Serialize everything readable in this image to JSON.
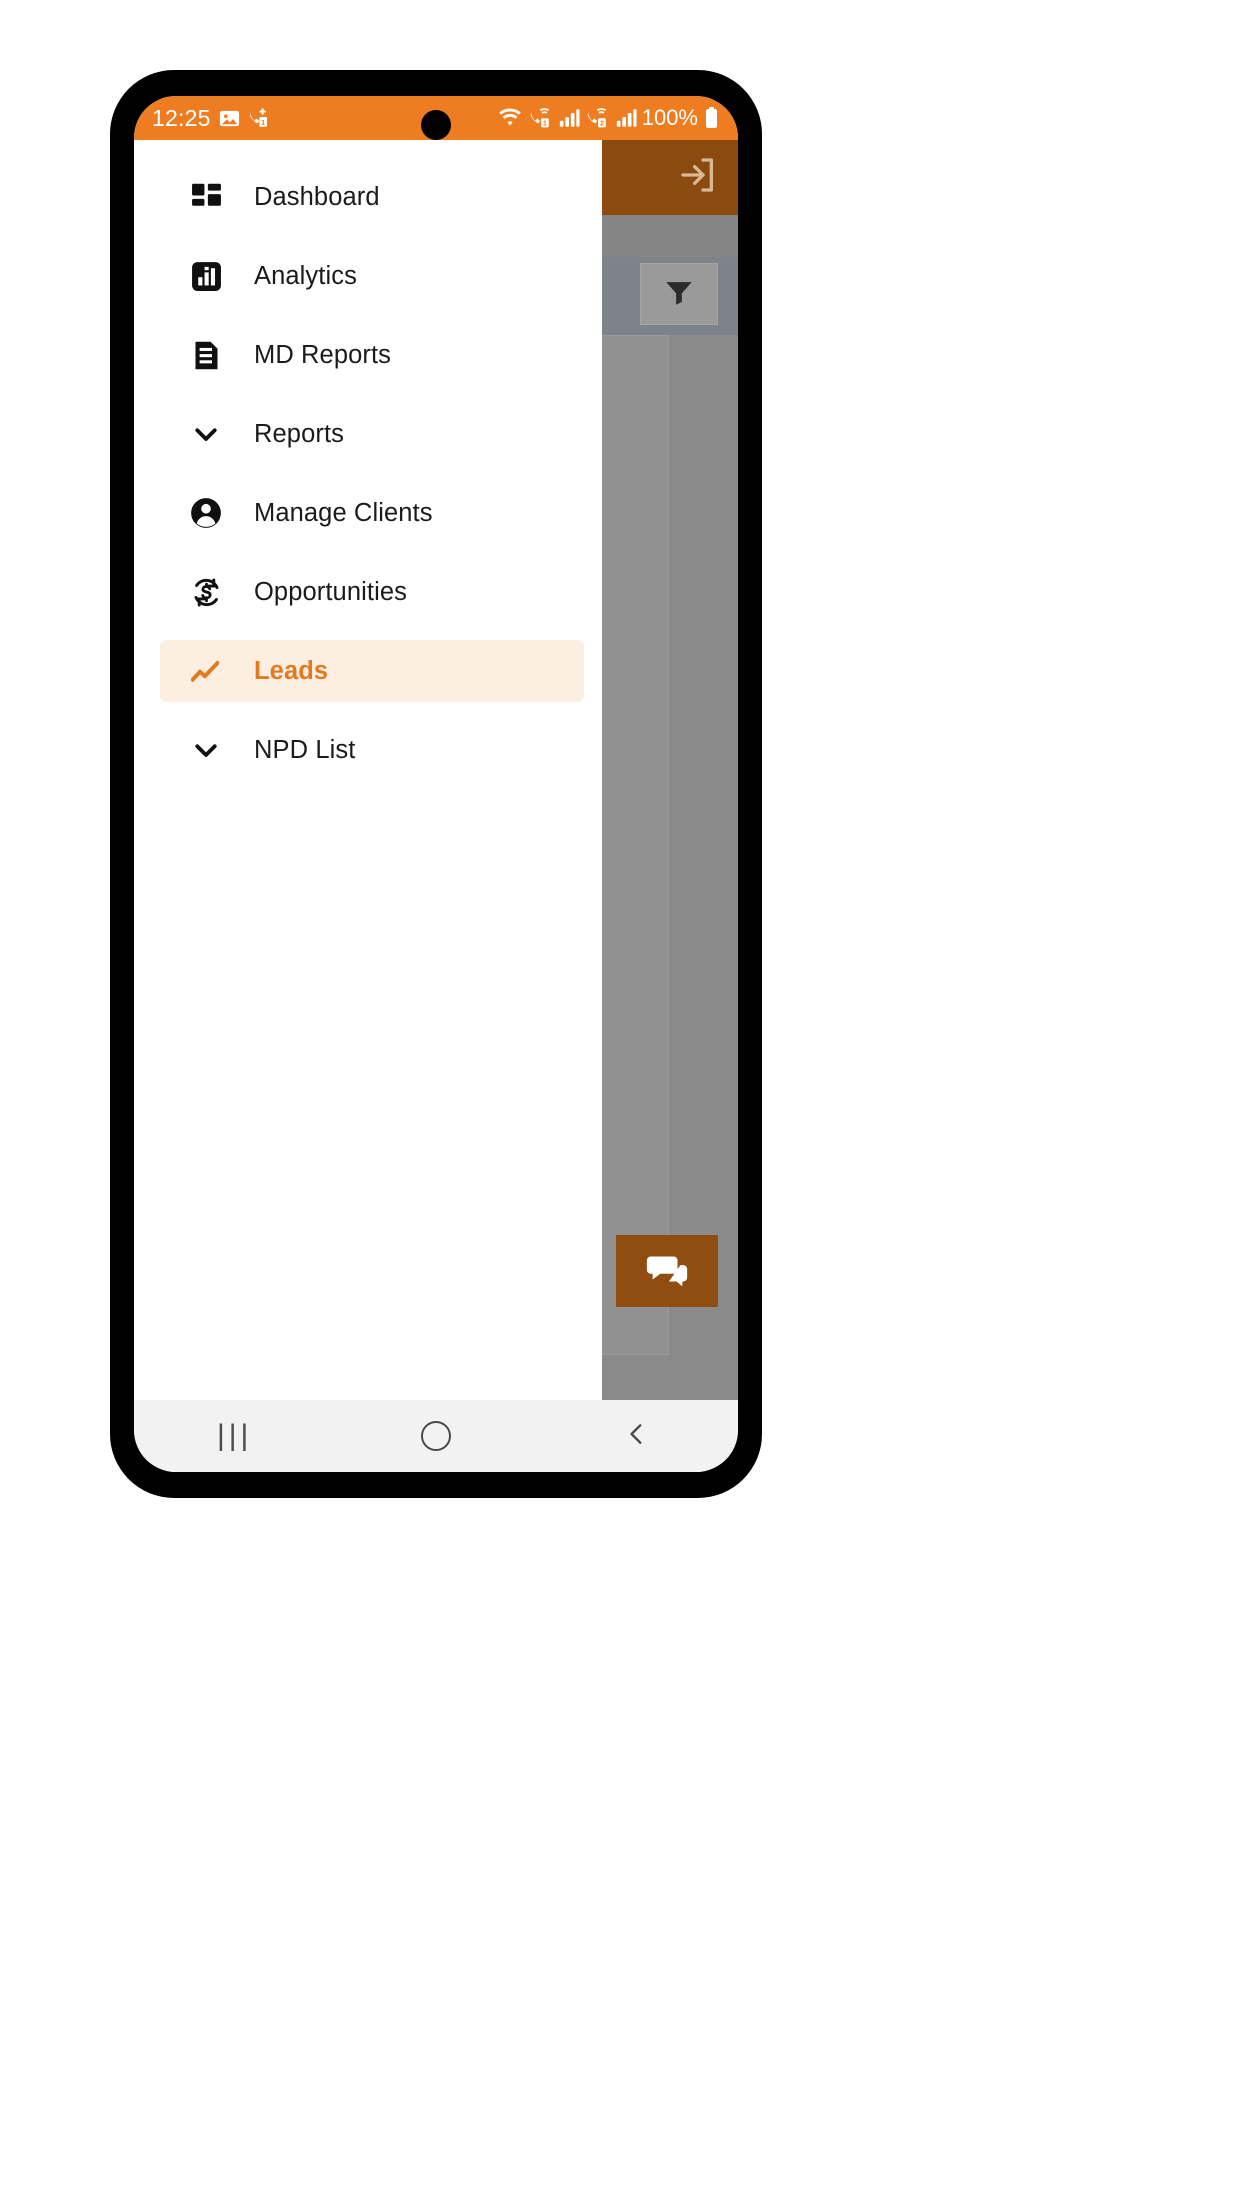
{
  "status_bar": {
    "time": "12:25",
    "battery_percent": "100%",
    "left_icons": [
      "photo-icon",
      "missed-call-sim1-icon"
    ],
    "right_icons": [
      "wifi-icon",
      "call-sim1-icon",
      "signal-bars-1-icon",
      "call-sim2-icon",
      "signal-bars-2-icon",
      "battery-icon"
    ],
    "background_color": "#ED7D20"
  },
  "drawer": {
    "background_color": "#FFFFFF",
    "active_item_background": "#FDEEE2",
    "active_item_color": "#E07B22",
    "items": [
      {
        "label": "Dashboard",
        "icon": "dashboard-grid-icon",
        "active": false,
        "expandable": false
      },
      {
        "label": "Analytics",
        "icon": "bar-chart-square-icon",
        "active": false,
        "expandable": false
      },
      {
        "label": "MD Reports",
        "icon": "document-lines-icon",
        "active": false,
        "expandable": false
      },
      {
        "label": "Reports",
        "icon": "chevron-down-icon",
        "active": false,
        "expandable": true
      },
      {
        "label": "Manage Clients",
        "icon": "account-circle-icon",
        "active": false,
        "expandable": false
      },
      {
        "label": "Opportunities",
        "icon": "currency-exchange-icon",
        "active": false,
        "expandable": false
      },
      {
        "label": "Leads",
        "icon": "trending-zigzag-icon",
        "active": true,
        "expandable": false
      },
      {
        "label": "NPD List",
        "icon": "chevron-down-icon",
        "active": false,
        "expandable": true
      }
    ]
  },
  "background_app": {
    "appbar_color": "#8A4A10",
    "logout_icon": "logout-arrow-icon",
    "filter_icon": "filter-funnel-icon",
    "add_button_label": "+",
    "chat_icon": "chat-bubbles-icon",
    "dim_overlay_color": "#8A8A8A"
  },
  "system_nav": {
    "recents_icon": "recents-icon",
    "home_icon": "home-circle-icon",
    "back_icon": "back-chevron-icon"
  }
}
